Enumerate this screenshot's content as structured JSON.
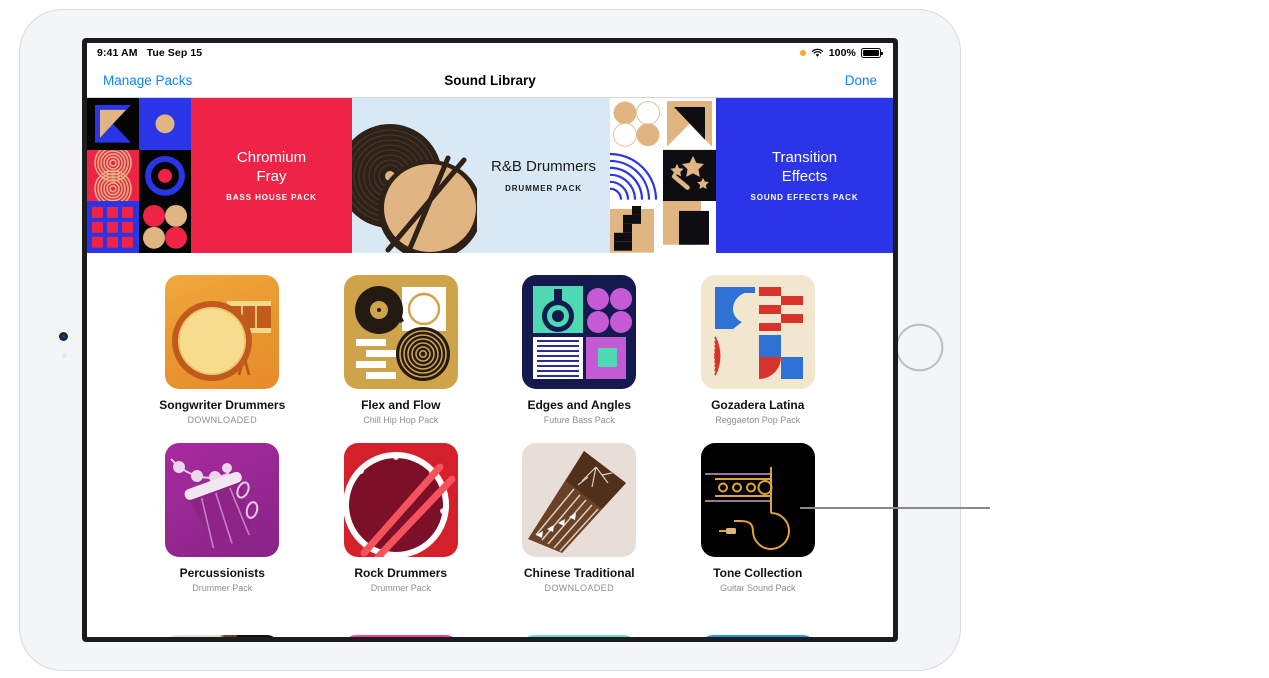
{
  "status_bar": {
    "time": "9:41 AM",
    "date": "Tue Sep 15",
    "battery_percent": "100%",
    "orange_dot": "recording-indicator",
    "wifi_icon": "wifi-icon",
    "battery_icon": "battery-full-icon"
  },
  "nav_bar": {
    "left_button": "Manage Packs",
    "title": "Sound Library",
    "right_button": "Done"
  },
  "banners": [
    {
      "title_line1": "Chromium",
      "title_line2": "Fray",
      "subtitle": "BASS HOUSE PACK",
      "bg": "#EE2346",
      "theme": "dark"
    },
    {
      "title_line1": "R&B Drummers",
      "title_line2": "",
      "subtitle": "DRUMMER PACK",
      "bg": "#D8E9F5",
      "theme": "light"
    },
    {
      "title_line1": "Transition",
      "title_line2": "Effects",
      "subtitle": "SOUND EFFECTS PACK",
      "bg": "#2B35E8",
      "theme": "dark"
    }
  ],
  "packs": [
    {
      "title": "Songwriter Drummers",
      "subtitle": "DOWNLOADED",
      "downloaded": true,
      "art": "songwriter-drummers"
    },
    {
      "title": "Flex and Flow",
      "subtitle": "Chill Hip Hop Pack",
      "downloaded": false,
      "art": "flex-and-flow"
    },
    {
      "title": "Edges and Angles",
      "subtitle": "Future Bass Pack",
      "downloaded": false,
      "art": "edges-and-angles"
    },
    {
      "title": "Gozadera Latina",
      "subtitle": "Reggaeton Pop Pack",
      "downloaded": false,
      "art": "gozadera-latina"
    },
    {
      "title": "Percussionists",
      "subtitle": "Drummer Pack",
      "downloaded": false,
      "art": "percussionists"
    },
    {
      "title": "Rock Drummers",
      "subtitle": "Drummer Pack",
      "downloaded": false,
      "art": "rock-drummers"
    },
    {
      "title": "Chinese Traditional",
      "subtitle": "DOWNLOADED",
      "downloaded": true,
      "art": "chinese-traditional"
    },
    {
      "title": "Tone Collection",
      "subtitle": "Guitar Sound Pack",
      "downloaded": false,
      "art": "tone-collection"
    }
  ],
  "partial_row_colors": [
    "#E8E0D2",
    "#FF3E9A",
    "#6EDCC0",
    "#1C9BE0"
  ],
  "callout": {
    "line_color": "#8a8a8e",
    "from": "tone-collection-thumb"
  },
  "colors": {
    "accent_blue": "#0a84ff",
    "title_black": "#111111",
    "subtitle_gray": "#8e8e93"
  }
}
